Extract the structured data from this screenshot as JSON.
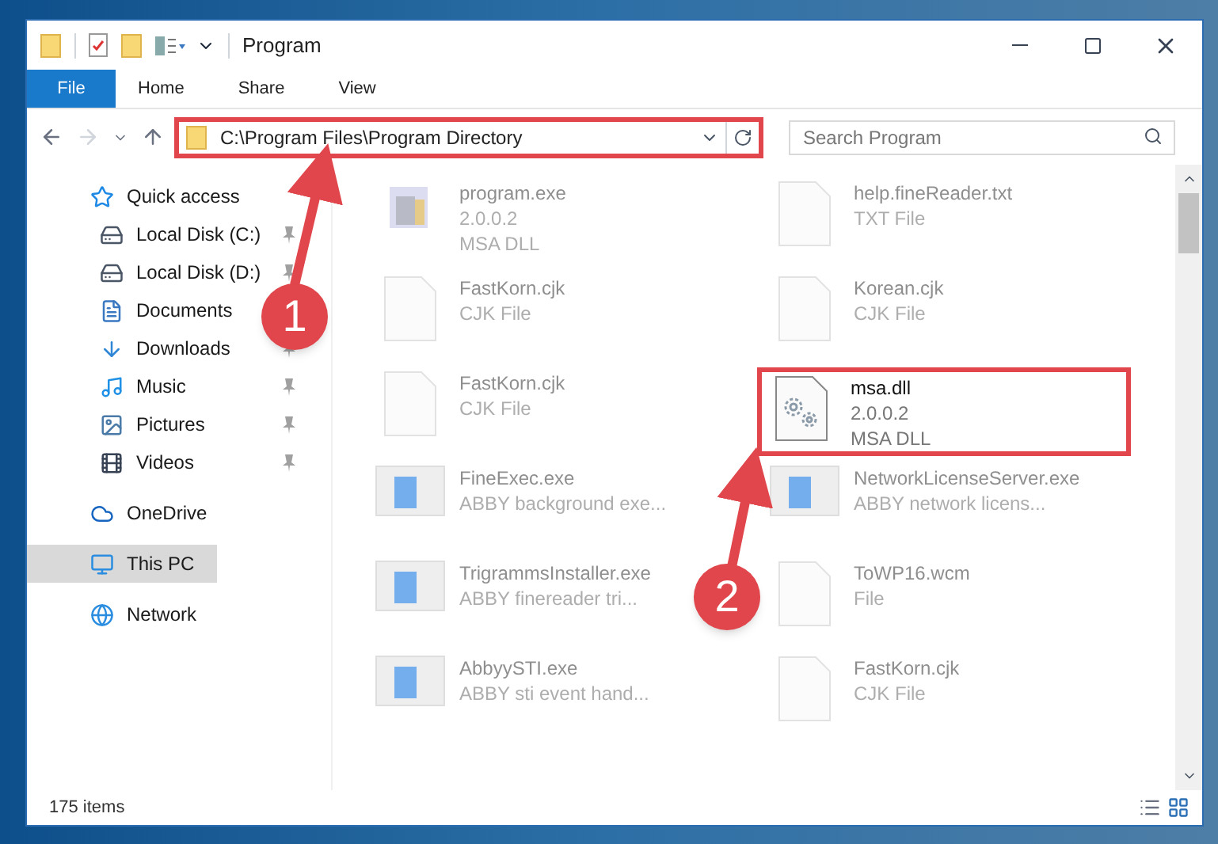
{
  "window": {
    "title": "Program"
  },
  "ribbon_tabs": [
    {
      "label": "File",
      "selected": true
    },
    {
      "label": "Home",
      "selected": false
    },
    {
      "label": "Share",
      "selected": false
    },
    {
      "label": "View",
      "selected": false
    }
  ],
  "address": {
    "path": "C:\\Program Files\\Program Directory"
  },
  "search": {
    "placeholder": "Search Program"
  },
  "sidebar": {
    "items": [
      {
        "label": "Quick access",
        "kind": "quick",
        "selected": false,
        "children": [
          {
            "label": "Local Disk (C:)",
            "kind": "diskc",
            "pinned": true
          },
          {
            "label": "Local Disk (D:)",
            "kind": "disk",
            "pinned": true
          },
          {
            "label": "Documents",
            "kind": "docs",
            "pinned": false
          },
          {
            "label": "Downloads",
            "kind": "downloads",
            "pinned": true
          },
          {
            "label": "Music",
            "kind": "music",
            "pinned": true
          },
          {
            "label": "Pictures",
            "kind": "pictures",
            "pinned": true
          },
          {
            "label": "Videos",
            "kind": "videos",
            "pinned": true
          }
        ]
      },
      {
        "label": "OneDrive",
        "kind": "cloud",
        "selected": false
      },
      {
        "label": "This PC",
        "kind": "pc",
        "selected": true
      },
      {
        "label": "Network",
        "kind": "network",
        "selected": false
      }
    ]
  },
  "files": [
    {
      "name": "program.exe",
      "details": [
        "2.0.0.2",
        "MSA DLL"
      ],
      "kind": "program",
      "highlighted": false
    },
    {
      "name": "help.fineReader.txt",
      "details": [
        "TXT File"
      ],
      "kind": "doc",
      "highlighted": false
    },
    {
      "name": "FastKorn.cjk",
      "details": [
        "CJK File"
      ],
      "kind": "doc",
      "highlighted": false
    },
    {
      "name": "Korean.cjk",
      "details": [
        "CJK File"
      ],
      "kind": "doc",
      "highlighted": false
    },
    {
      "name": "FastKorn.cjk",
      "details": [
        "CJK File"
      ],
      "kind": "doc",
      "highlighted": false
    },
    {
      "name": "msa.dll",
      "details": [
        "2.0.0.2",
        "MSA DLL"
      ],
      "kind": "dll",
      "highlighted": true
    },
    {
      "name": "FineExec.exe",
      "details": [
        "ABBY background exe..."
      ],
      "kind": "app",
      "highlighted": false
    },
    {
      "name": "NetworkLicenseServer.exe",
      "details": [
        "ABBY network licens..."
      ],
      "kind": "app",
      "highlighted": false
    },
    {
      "name": "TrigrammsInstaller.exe",
      "details": [
        "ABBY finereader tri..."
      ],
      "kind": "app",
      "highlighted": false
    },
    {
      "name": "ToWP16.wcm",
      "details": [
        "File"
      ],
      "kind": "doc",
      "highlighted": false
    },
    {
      "name": "AbbyySTI.exe",
      "details": [
        "ABBY sti event hand..."
      ],
      "kind": "app",
      "highlighted": false
    },
    {
      "name": "FastKorn.cjk",
      "details": [
        "CJK File"
      ],
      "kind": "doc",
      "highlighted": false
    }
  ],
  "status_bar": {
    "count": "175 items"
  },
  "annotations": [
    {
      "label": "1"
    },
    {
      "label": "2"
    }
  ]
}
